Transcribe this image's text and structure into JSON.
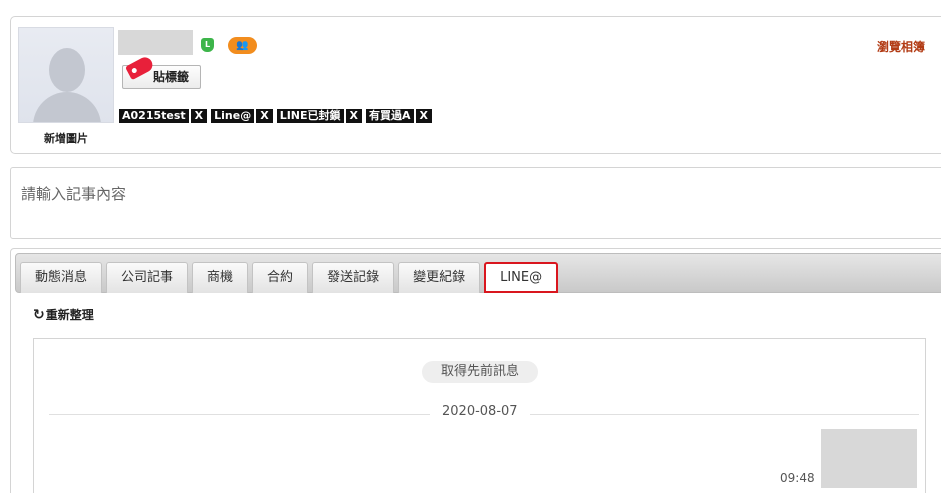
{
  "profile": {
    "add_image_label": "新增圖片",
    "line_icon_letter": "L",
    "group_icon_glyph": "👥",
    "tag_button_label": "貼標籤",
    "browse_album_label": "瀏覽相簿",
    "tags": [
      {
        "label": "A0215test",
        "remove": "X"
      },
      {
        "label": "Line@",
        "remove": "X"
      },
      {
        "label": "LINE已封鎖",
        "remove": "X"
      },
      {
        "label": "有買過A",
        "remove": "X"
      }
    ]
  },
  "note": {
    "placeholder": "請輸入記事內容"
  },
  "tabs": [
    {
      "label": "動態消息"
    },
    {
      "label": "公司記事"
    },
    {
      "label": "商機"
    },
    {
      "label": "合約"
    },
    {
      "label": "發送記錄"
    },
    {
      "label": "變更紀錄"
    },
    {
      "label": "LINE@"
    }
  ],
  "active_tab": "LINE@",
  "chat": {
    "refresh_label": "重新整理",
    "refresh_icon": "↻",
    "previous_messages_label": "取得先前訊息",
    "date_separator": "2020-08-07",
    "messages": [
      {
        "time": "09:48"
      }
    ]
  },
  "colors": {
    "accent_red": "#d9161e",
    "album_link": "#b23b14",
    "line_green": "#3db54a",
    "group_orange": "#f28d1e"
  }
}
